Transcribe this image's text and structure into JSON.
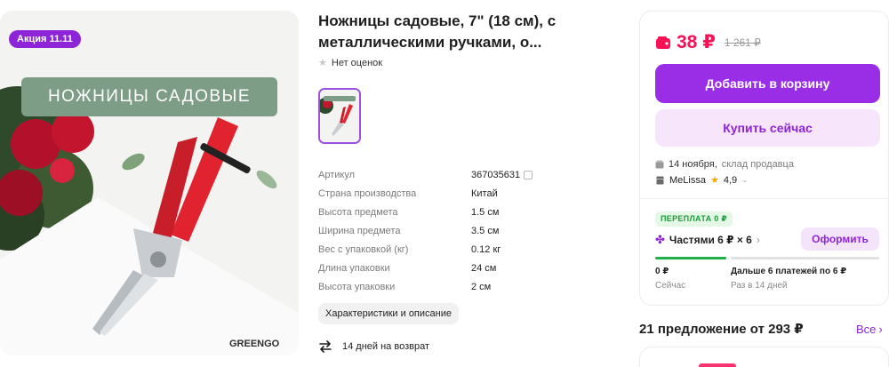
{
  "product": {
    "promo_badge": "Акция 11.11",
    "banner_text": "НОЖНИЦЫ САДОВЫЕ",
    "brand_logo": "GREENGO",
    "title": "Ножницы садовые, 7\" (18 см), с металлическими ручками, о...",
    "rating_text": "Нет оценок",
    "specs": [
      {
        "name": "Артикул",
        "value": "367035631"
      },
      {
        "name": "Страна производства",
        "value": "Китай"
      },
      {
        "name": "Высота предмета",
        "value": "1.5 см"
      },
      {
        "name": "Ширина предмета",
        "value": "3.5 см"
      },
      {
        "name": "Вес с упаковкой (кг)",
        "value": "0.12 кг"
      },
      {
        "name": "Длина упаковки",
        "value": "24 см"
      },
      {
        "name": "Высота упаковки",
        "value": "2 см"
      }
    ],
    "description_button": "Характеристики и описание",
    "return_text": "14 дней на возврат"
  },
  "buy": {
    "price": "38 ₽",
    "old_price": "1 261 ₽",
    "add_to_cart": "Добавить в корзину",
    "buy_now": "Купить сейчас",
    "delivery_date": "14 ноября,",
    "delivery_source": "склад продавца",
    "seller_name": "MeLissa",
    "seller_rating": "4,9",
    "overpay_badge": "ПЕРЕПЛАТА 0 ₽",
    "installments": "Частями 6 ₽ × 6",
    "order_button": "Оформить",
    "pay_now_amount": "0 ₽",
    "pay_now_label": "Сейчас",
    "pay_later_amount": "Дальше 6 платежей по 6 ₽",
    "pay_later_label": "Раз в 14 дней"
  },
  "offers": {
    "heading": "21 предложение от 293 ₽",
    "all_link": "Все"
  },
  "colors": {
    "accent": "#9a2ee6",
    "price": "#f91155",
    "success": "#21b04b"
  }
}
